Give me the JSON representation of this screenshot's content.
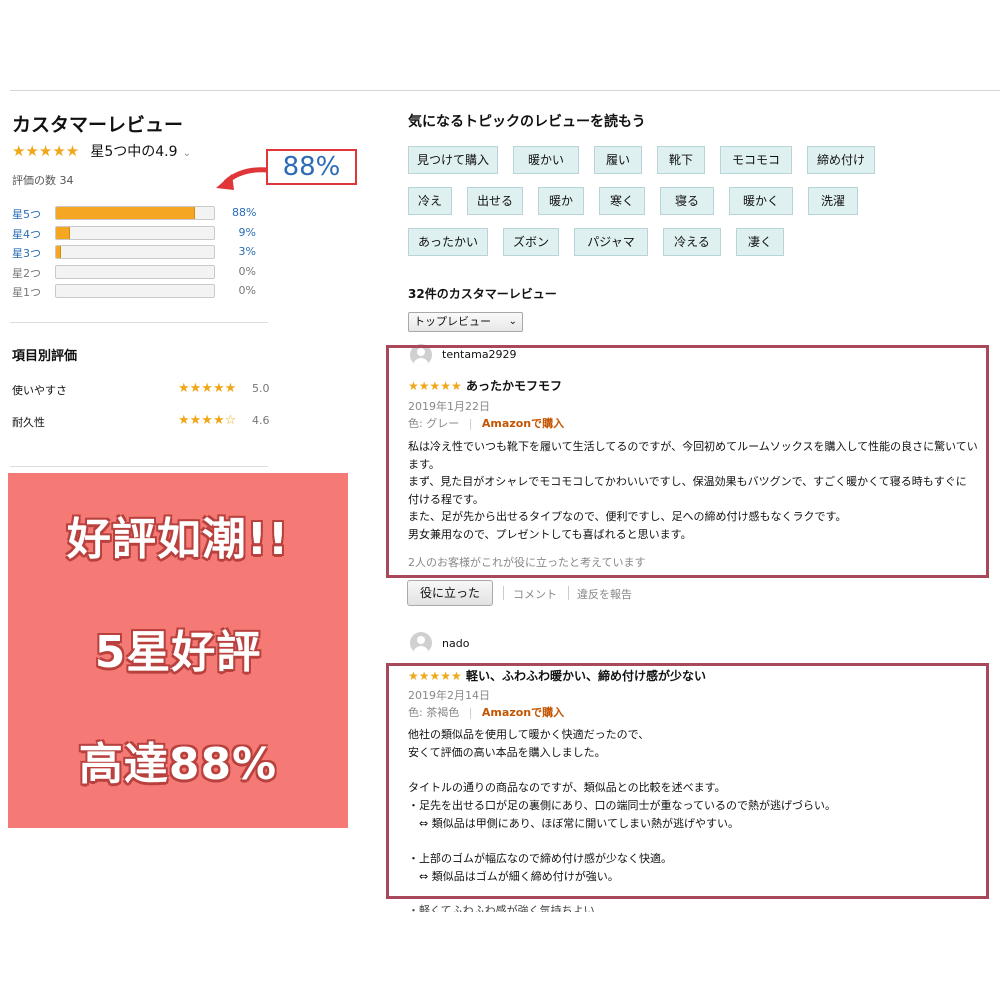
{
  "left": {
    "title": "カスタマーレビュー",
    "stars": "★★★★★",
    "rating_text": "星5つ中の4.9",
    "count_text": "評価の数 34",
    "highlight_pct": "88%",
    "histogram": [
      {
        "label": "星5つ",
        "pct": "88%",
        "value": 88,
        "linked": true
      },
      {
        "label": "星4つ",
        "pct": "9%",
        "value": 9,
        "linked": true
      },
      {
        "label": "星3つ",
        "pct": "3%",
        "value": 3,
        "linked": true
      },
      {
        "label": "星2つ",
        "pct": "0%",
        "value": 0,
        "linked": false
      },
      {
        "label": "星1つ",
        "pct": "0%",
        "value": 0,
        "linked": false
      }
    ],
    "attr_title": "項目別評価",
    "attributes": [
      {
        "name": "使いやすさ",
        "stars": "★★★★★",
        "value": "5.0"
      },
      {
        "name": "耐久性",
        "stars": "★★★★☆",
        "value": "4.6"
      }
    ]
  },
  "promo": {
    "line1": "好評如潮!!",
    "line2": "5星好評",
    "line3": "高達88%"
  },
  "topics": {
    "title": "気になるトピックのレビューを読もう",
    "rows": [
      [
        "見つけて購入",
        "暖かい",
        "履い",
        "靴下",
        "モコモコ",
        "締め付け"
      ],
      [
        "冷え",
        "出せる",
        "暖か",
        "寒く",
        "寝る",
        "暖かく",
        "洗濯"
      ],
      [
        "あったかい",
        "ズボン",
        "パジャマ",
        "冷える",
        "凄く"
      ]
    ]
  },
  "reviews_header": {
    "count_text": "32件のカスタマーレビュー",
    "sort_label": "トップレビュー"
  },
  "review1": {
    "user": "tentama2929",
    "stars": "★★★★★",
    "title": "あったかモフモフ",
    "date": "2019年1月22日",
    "color": "色: グレー",
    "badge": "Amazonで購入",
    "lines": [
      "私は冷え性でいつも靴下を履いて生活してるのですが、今回初めてルームソックスを購入して性能の良さに驚いてい",
      "ます。",
      "まず、見た目がオシャレでモコモコしてかわいいですし、保温効果もバツグンで、すごく暖かくて寝る時もすぐに",
      "付ける程です。",
      "また、足が先から出せるタイプなので、便利ですし、足への締め付け感もなくラクです。",
      "男女兼用なので、プレゼントしても喜ばれると思います。"
    ],
    "helpful": "2人のお客様がこれが役に立ったと考えています",
    "btn_helpful": "役に立った",
    "comment": "コメント",
    "report": "違反を報告"
  },
  "review2": {
    "user": "nado",
    "stars": "★★★★★",
    "title": "軽い、ふわふわ暖かい、締め付け感が少ない",
    "date": "2019年2月14日",
    "color": "色: 茶褐色",
    "badge": "Amazonで購入",
    "lines": [
      "他社の類似品を使用して暖かく快適だったので、",
      "安くて評価の高い本品を購入しました。",
      "",
      "タイトルの通りの商品なのですが、類似品との比較を述べます。",
      "・足先を出せる口が足の裏側にあり、口の端同士が重なっているので熱が逃げづらい。",
      "　⇔ 類似品は甲側にあり、ほぼ常に開いてしまい熱が逃げやすい。",
      "",
      "・上部のゴムが幅広なので締め付け感が少なく快適。",
      "　⇔ 類似品はゴムが細く締め付けが強い。"
    ],
    "cut_line": "・軽くてふわふわ感が強く気持ちよい"
  },
  "colors": {
    "accent_star": "#f0a81b",
    "link": "#2a6db5",
    "promo_bg": "#f57a76",
    "frame": "#a8485a",
    "tag_bg": "#dff0f1",
    "badge": "#c45500"
  }
}
